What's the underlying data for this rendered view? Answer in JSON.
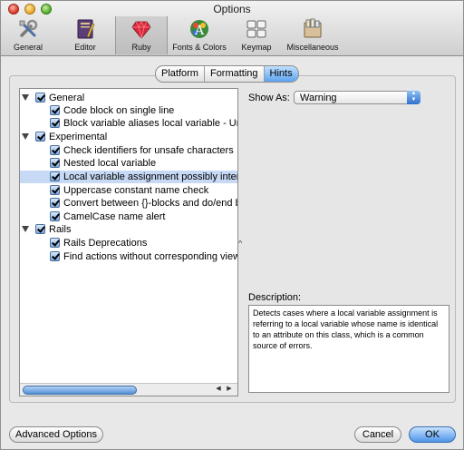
{
  "window": {
    "title": "Options"
  },
  "toolbar": {
    "items": [
      {
        "label": "General",
        "icon": "general-tools-icon"
      },
      {
        "label": "Editor",
        "icon": "editor-icon"
      },
      {
        "label": "Ruby",
        "icon": "ruby-gem-icon",
        "selected": true
      },
      {
        "label": "Fonts & Colors",
        "icon": "fonts-colors-icon"
      },
      {
        "label": "Keymap",
        "icon": "keymap-icon"
      },
      {
        "label": "Miscellaneous",
        "icon": "miscellaneous-icon"
      }
    ]
  },
  "tabs": [
    {
      "label": "Platform"
    },
    {
      "label": "Formatting"
    },
    {
      "label": "Hints",
      "active": true
    }
  ],
  "tree": {
    "rows": [
      {
        "label": "General",
        "checked": true,
        "expanded": true,
        "level": 0
      },
      {
        "label": "Code block on single line",
        "checked": true,
        "level": 1
      },
      {
        "label": "Block variable aliases local variable - Un",
        "checked": true,
        "level": 1
      },
      {
        "label": "Experimental",
        "checked": true,
        "expanded": true,
        "level": 0
      },
      {
        "label": "Check identifiers for unsafe characters",
        "checked": true,
        "level": 1
      },
      {
        "label": "Nested local variable",
        "checked": true,
        "level": 1
      },
      {
        "label": "Local variable assignment possibly inter",
        "checked": true,
        "level": 1,
        "selected": true
      },
      {
        "label": "Uppercase constant name check",
        "checked": true,
        "level": 1
      },
      {
        "label": "Convert between {}-blocks and do/end b",
        "checked": true,
        "level": 1
      },
      {
        "label": "CamelCase name alert",
        "checked": true,
        "level": 1
      },
      {
        "label": "Rails",
        "checked": true,
        "expanded": true,
        "level": 0
      },
      {
        "label": "Rails Deprecations",
        "checked": true,
        "level": 1
      },
      {
        "label": "Find actions without corresponding view",
        "checked": true,
        "level": 1
      }
    ],
    "scroll_left_arrow": "◀",
    "scroll_right_arrow": "▶",
    "caret_mark": "^"
  },
  "hint_settings": {
    "show_as_label": "Show As:",
    "show_as_value": "Warning",
    "description_label": "Description:",
    "description_text": "Detects cases where a local variable assignment is referring to a local variable whose name is identical to an attribute on this class, which is a common source of errors."
  },
  "buttons": {
    "advanced": "Advanced Options",
    "cancel": "Cancel",
    "ok": "OK"
  },
  "colors": {
    "selection": "#c7d9f4",
    "accent": "#4d95ea"
  }
}
